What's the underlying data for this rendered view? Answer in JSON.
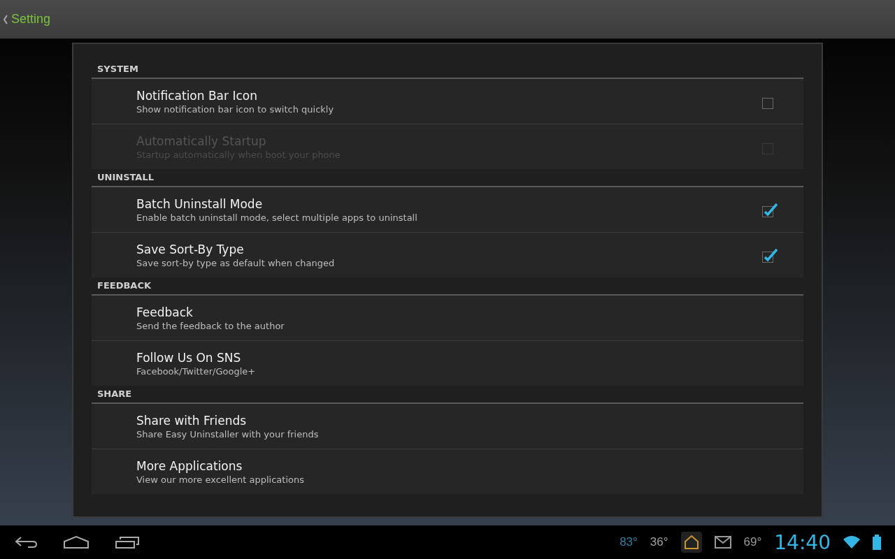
{
  "action_bar": {
    "title": "Setting"
  },
  "sections": [
    {
      "title": "SYSTEM",
      "items": [
        {
          "kind": "checkbox",
          "title": "Notification Bar Icon",
          "summary": "Show notification bar icon to switch quickly",
          "checked": false,
          "disabled": false
        },
        {
          "kind": "checkbox",
          "title": "Automatically Startup",
          "summary": "Startup automatically when boot your phone",
          "checked": false,
          "disabled": true
        }
      ]
    },
    {
      "title": "UNINSTALL",
      "items": [
        {
          "kind": "checkbox",
          "title": "Batch Uninstall Mode",
          "summary": "Enable batch uninstall mode, select multiple apps to uninstall",
          "checked": true,
          "disabled": false
        },
        {
          "kind": "checkbox",
          "title": "Save Sort-By Type",
          "summary": "Save sort-by type as default when changed",
          "checked": true,
          "disabled": false
        }
      ]
    },
    {
      "title": "FEEDBACK",
      "items": [
        {
          "kind": "plain",
          "title": "Feedback",
          "summary": "Send the feedback to the author",
          "disabled": false
        },
        {
          "kind": "plain",
          "title": "Follow Us On SNS",
          "summary": "Facebook/Twitter/Google+",
          "disabled": false
        }
      ]
    },
    {
      "title": "SHARE",
      "items": [
        {
          "kind": "plain",
          "title": "Share with Friends",
          "summary": "Share Easy Uninstaller with your friends",
          "disabled": false
        },
        {
          "kind": "plain",
          "title": "More Applications",
          "summary": "View our more excellent applications",
          "disabled": false
        }
      ]
    }
  ],
  "system_bar": {
    "notifications": [
      {
        "kind": "text",
        "text": "83°",
        "color": "#2e7fa3"
      },
      {
        "kind": "text",
        "text": "36°",
        "color": "#a0a0a0"
      },
      {
        "kind": "app"
      },
      {
        "kind": "mail"
      },
      {
        "kind": "text",
        "text": "69°",
        "color": "#9a9a9a"
      }
    ],
    "time": "14:40"
  }
}
